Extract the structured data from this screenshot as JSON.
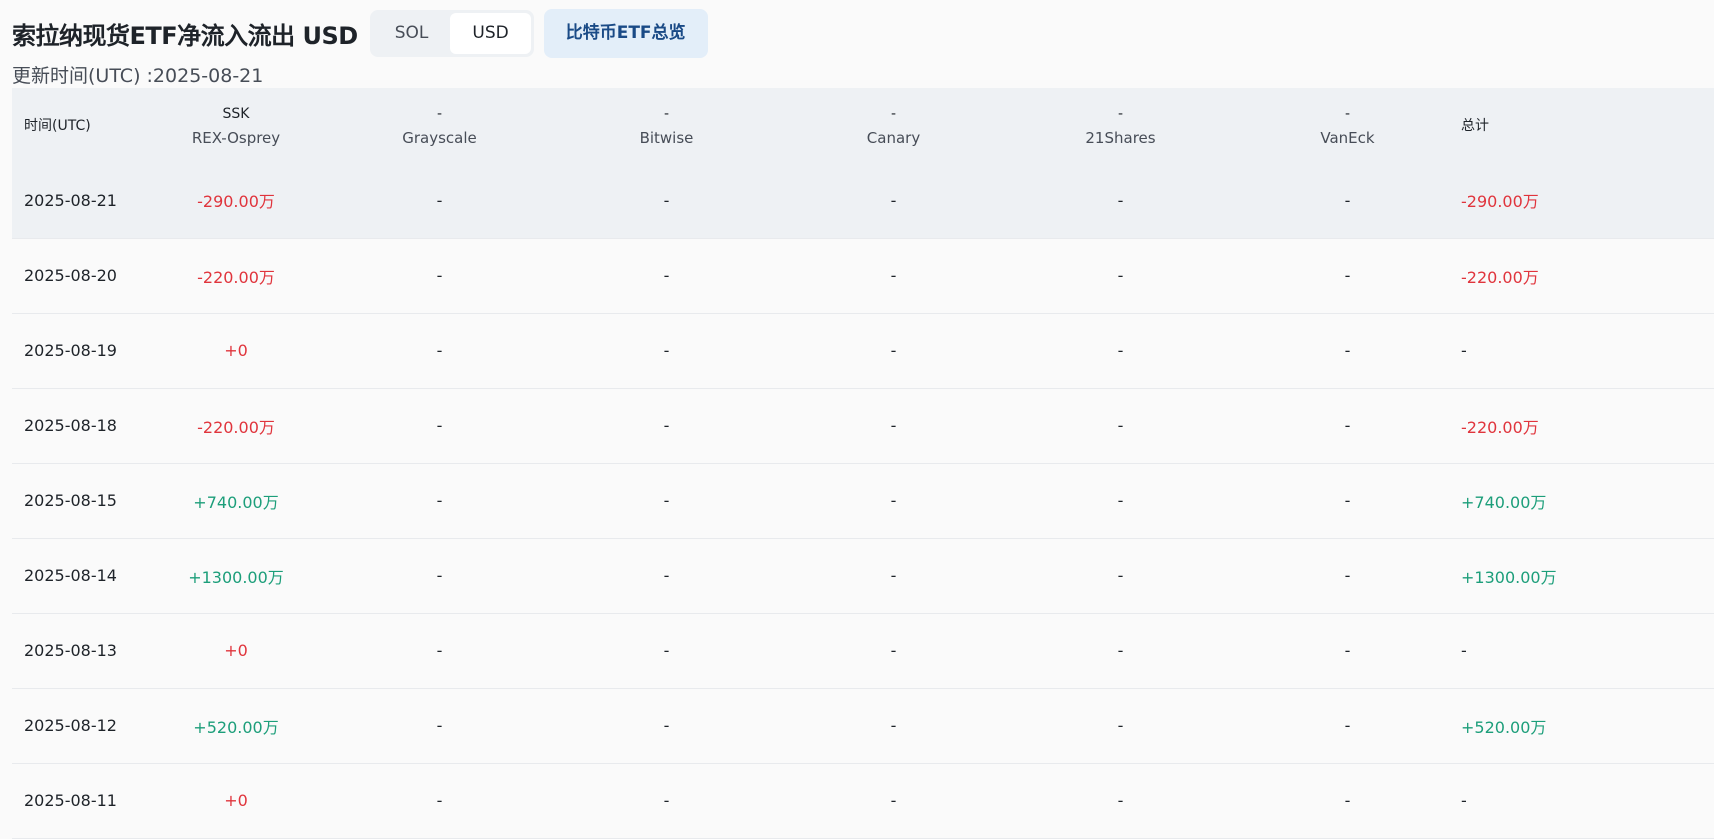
{
  "header": {
    "title": "索拉纳现货ETF净流入流出 USD",
    "toggle_options": [
      "SOL",
      "USD"
    ],
    "toggle_selected": "USD",
    "overview_button": "比特币ETF总览",
    "updated": "更新时间(UTC) :2025-08-21"
  },
  "table": {
    "columns": [
      {
        "top": "时间(UTC)",
        "sub": ""
      },
      {
        "top": "SSK",
        "sub": "REX-Osprey"
      },
      {
        "top": "-",
        "sub": "Grayscale"
      },
      {
        "top": "-",
        "sub": "Bitwise"
      },
      {
        "top": "-",
        "sub": "Canary"
      },
      {
        "top": "-",
        "sub": "21Shares"
      },
      {
        "top": "-",
        "sub": "VanEck"
      },
      {
        "top": "总计",
        "sub": ""
      }
    ],
    "rows": [
      {
        "date": "2025-08-21",
        "ssk": "-290.00万",
        "grayscale": "-",
        "bitwise": "-",
        "canary": "-",
        "shares21": "-",
        "vaneck": "-",
        "total": "-290.00万",
        "ssk_sign": "neg",
        "total_sign": "neg"
      },
      {
        "date": "2025-08-20",
        "ssk": "-220.00万",
        "grayscale": "-",
        "bitwise": "-",
        "canary": "-",
        "shares21": "-",
        "vaneck": "-",
        "total": "-220.00万",
        "ssk_sign": "neg",
        "total_sign": "neg"
      },
      {
        "date": "2025-08-19",
        "ssk": "+0",
        "grayscale": "-",
        "bitwise": "-",
        "canary": "-",
        "shares21": "-",
        "vaneck": "-",
        "total": "-",
        "ssk_sign": "neg",
        "total_sign": "dash"
      },
      {
        "date": "2025-08-18",
        "ssk": "-220.00万",
        "grayscale": "-",
        "bitwise": "-",
        "canary": "-",
        "shares21": "-",
        "vaneck": "-",
        "total": "-220.00万",
        "ssk_sign": "neg",
        "total_sign": "neg"
      },
      {
        "date": "2025-08-15",
        "ssk": "+740.00万",
        "grayscale": "-",
        "bitwise": "-",
        "canary": "-",
        "shares21": "-",
        "vaneck": "-",
        "total": "+740.00万",
        "ssk_sign": "pos",
        "total_sign": "pos"
      },
      {
        "date": "2025-08-14",
        "ssk": "+1300.00万",
        "grayscale": "-",
        "bitwise": "-",
        "canary": "-",
        "shares21": "-",
        "vaneck": "-",
        "total": "+1300.00万",
        "ssk_sign": "pos",
        "total_sign": "pos"
      },
      {
        "date": "2025-08-13",
        "ssk": "+0",
        "grayscale": "-",
        "bitwise": "-",
        "canary": "-",
        "shares21": "-",
        "vaneck": "-",
        "total": "-",
        "ssk_sign": "neg",
        "total_sign": "dash"
      },
      {
        "date": "2025-08-12",
        "ssk": "+520.00万",
        "grayscale": "-",
        "bitwise": "-",
        "canary": "-",
        "shares21": "-",
        "vaneck": "-",
        "total": "+520.00万",
        "ssk_sign": "pos",
        "total_sign": "pos"
      },
      {
        "date": "2025-08-11",
        "ssk": "+0",
        "grayscale": "-",
        "bitwise": "-",
        "canary": "-",
        "shares21": "-",
        "vaneck": "-",
        "total": "-",
        "ssk_sign": "neg",
        "total_sign": "dash"
      }
    ]
  },
  "colors": {
    "negative": "#e0343c",
    "positive": "#1c9e7a",
    "header_bg": "#eef1f4",
    "accent_button_bg": "#e3eef9",
    "accent_button_text": "#1a4a86"
  }
}
